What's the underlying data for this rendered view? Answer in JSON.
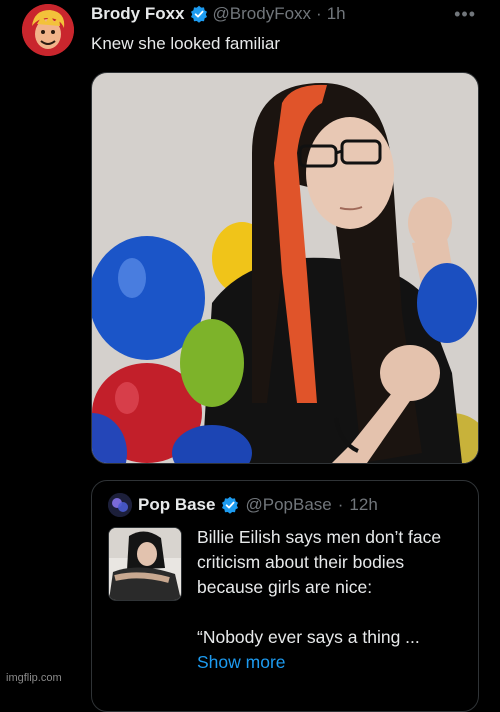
{
  "tweet": {
    "author_name": "Brody Foxx",
    "handle": "@BrodyFoxx",
    "separator": "·",
    "time": "1h",
    "more_icon": "more-horizontal-icon",
    "text": "Knew she looked familiar",
    "verified_color": "#1d9bf0",
    "media_description": "photo"
  },
  "quote": {
    "author_name": "Pop Base",
    "handle": "@PopBase",
    "separator": "·",
    "time": "12h",
    "text_line1": "Billie Eilish says men don’t face criticism about their bodies because girls are nice:",
    "text_line2": "“Nobody ever says a thing ...",
    "show_more": "Show more"
  },
  "watermark": "imgflip.com",
  "colors": {
    "background": "#000000",
    "text": "#e7e9ea",
    "secondary": "#71767b",
    "link": "#1d9bf0",
    "border": "#2f3336"
  }
}
